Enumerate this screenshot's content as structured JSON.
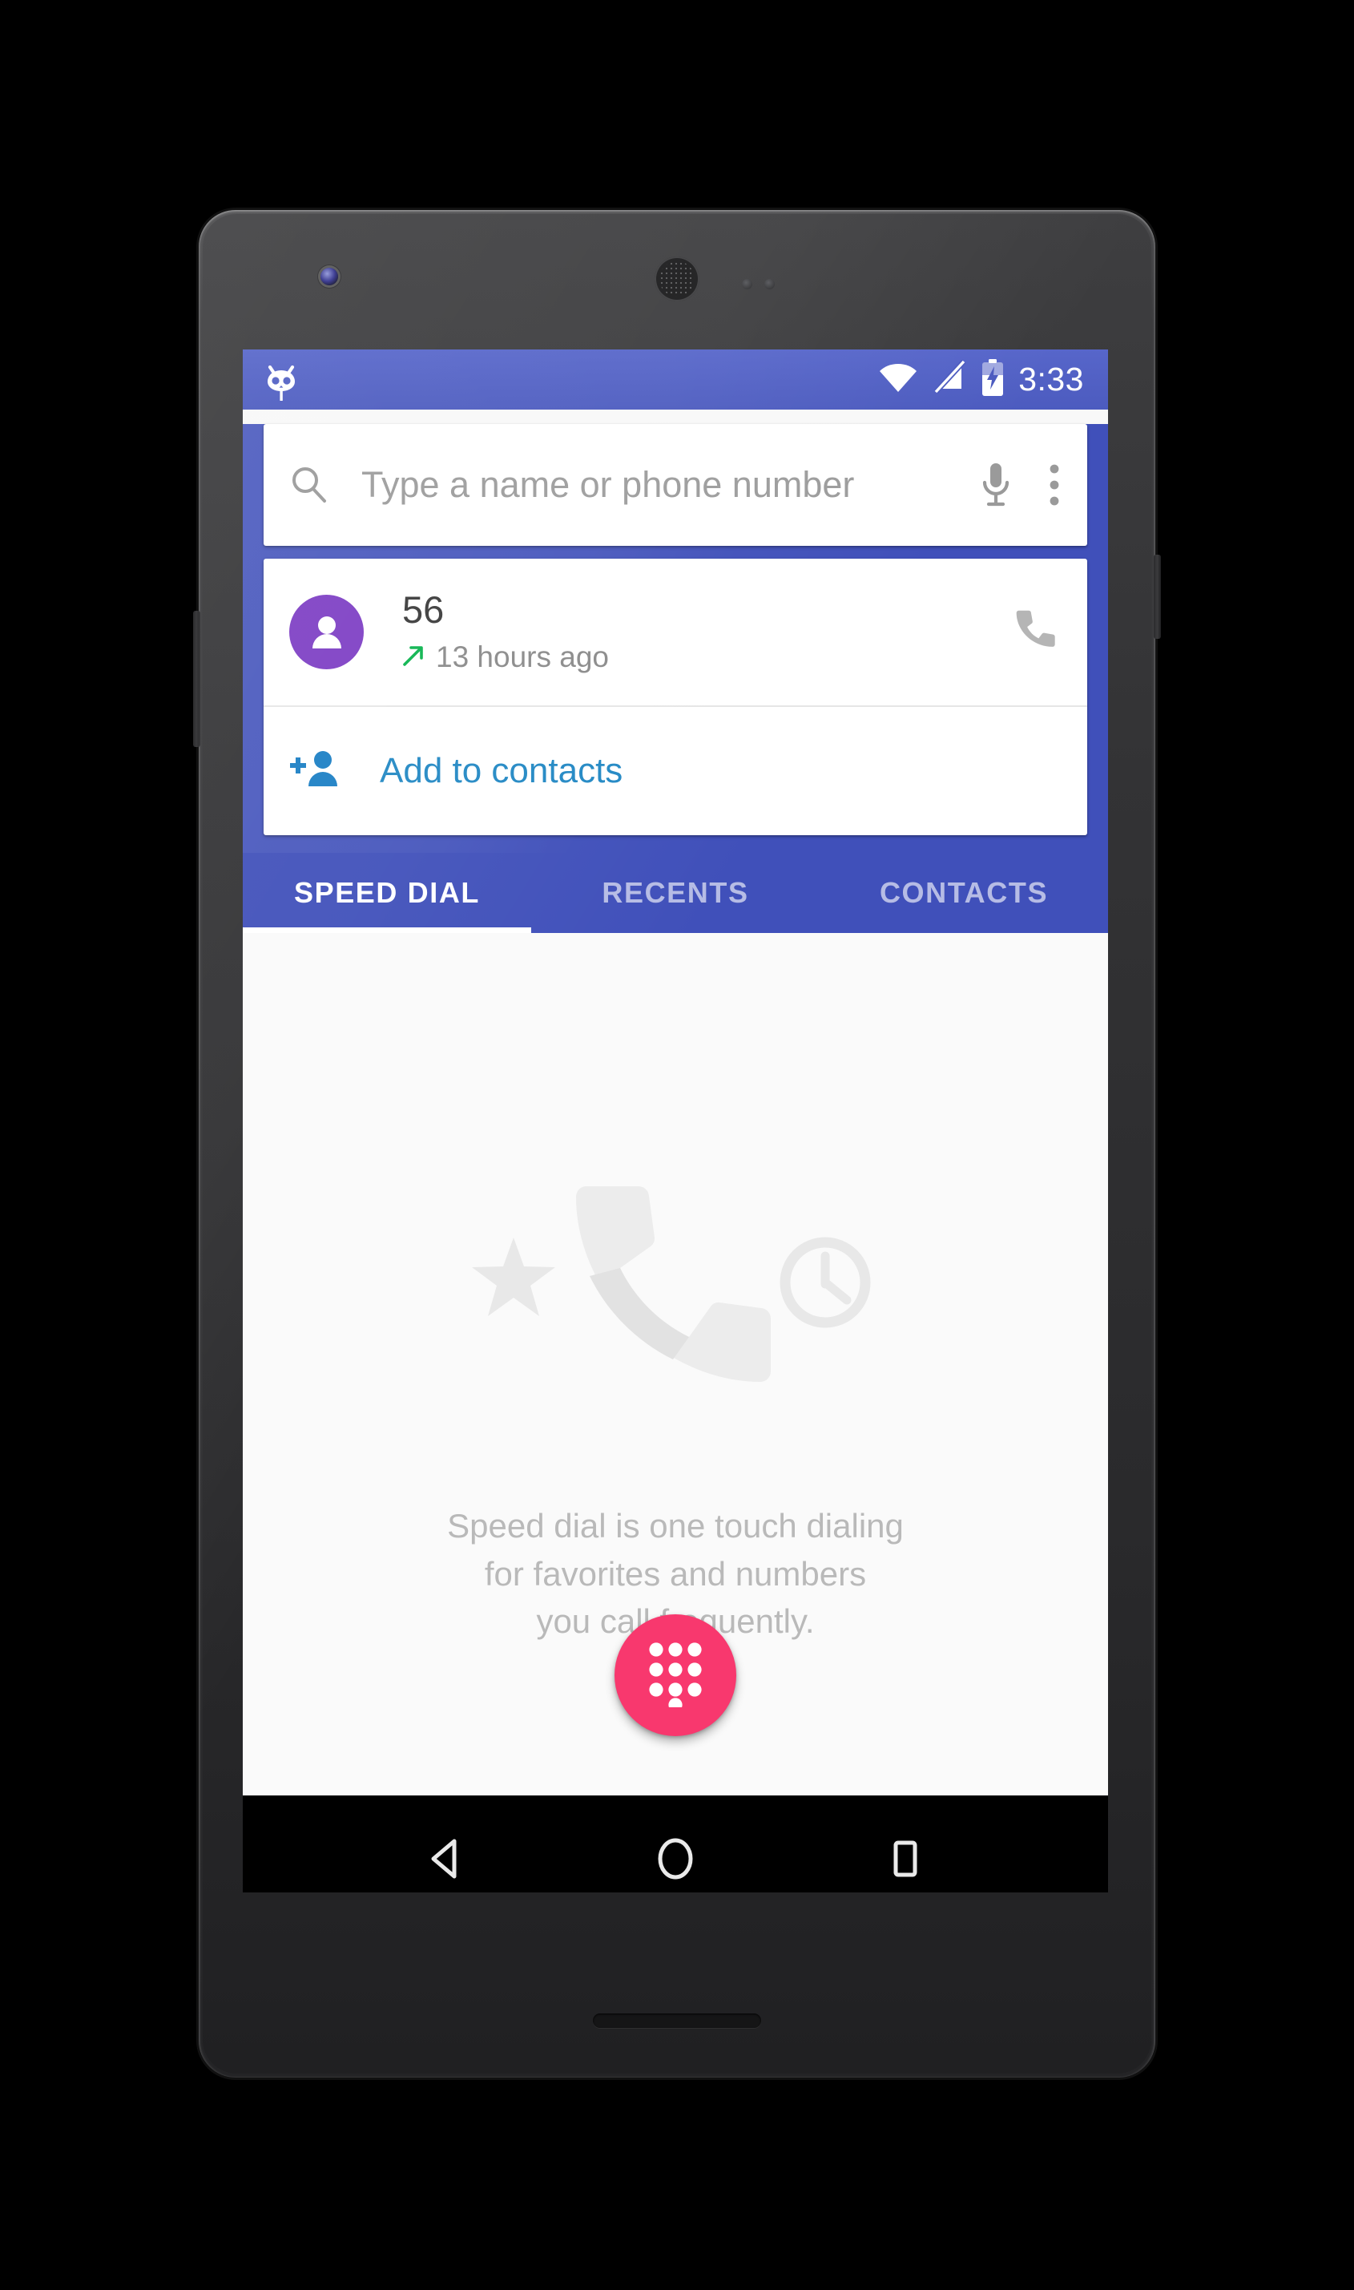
{
  "status_bar": {
    "logo_icon": "cyanogenmod-logo-icon",
    "wifi_icon": "wifi-icon",
    "signal_off_icon": "signal-off-icon",
    "battery_charging_icon": "battery-charging-icon",
    "time": "3:33"
  },
  "search": {
    "search_icon": "search-icon",
    "placeholder": "Type a name or phone number",
    "value": "",
    "mic_icon": "microphone-icon",
    "overflow_icon": "overflow-menu-icon"
  },
  "contact_card": {
    "avatar_icon": "person-avatar-icon",
    "name": "56",
    "call_direction_icon": "outgoing-call-arrow-icon",
    "time_ago": "13 hours ago",
    "call_icon": "phone-call-icon",
    "add_contact_icon": "add-person-icon",
    "add_contact_label": "Add to contacts"
  },
  "tabs": [
    {
      "label": "SPEED DIAL",
      "active": true
    },
    {
      "label": "RECENTS",
      "active": false
    },
    {
      "label": "CONTACTS",
      "active": false
    }
  ],
  "empty_state": {
    "star_icon": "star-icon",
    "phone_icon": "phone-handset-icon",
    "clock_icon": "clock-icon",
    "line1": "Speed dial is one touch dialing",
    "line2": "for favorites and numbers",
    "line3": "you call frequently."
  },
  "fab": {
    "icon": "dialpad-icon",
    "color": "#f8386e"
  },
  "nav_bar": {
    "back_icon": "back-triangle-icon",
    "home_icon": "home-circle-icon",
    "recents_icon": "recents-square-icon"
  },
  "colors": {
    "status_bar_blue": "#5160c4",
    "header_blue": "#4050ba",
    "accent_pink": "#f8386e",
    "link_blue": "#2288c4",
    "avatar_purple": "#7e3fc4",
    "outgoing_green": "#0ab44e"
  }
}
